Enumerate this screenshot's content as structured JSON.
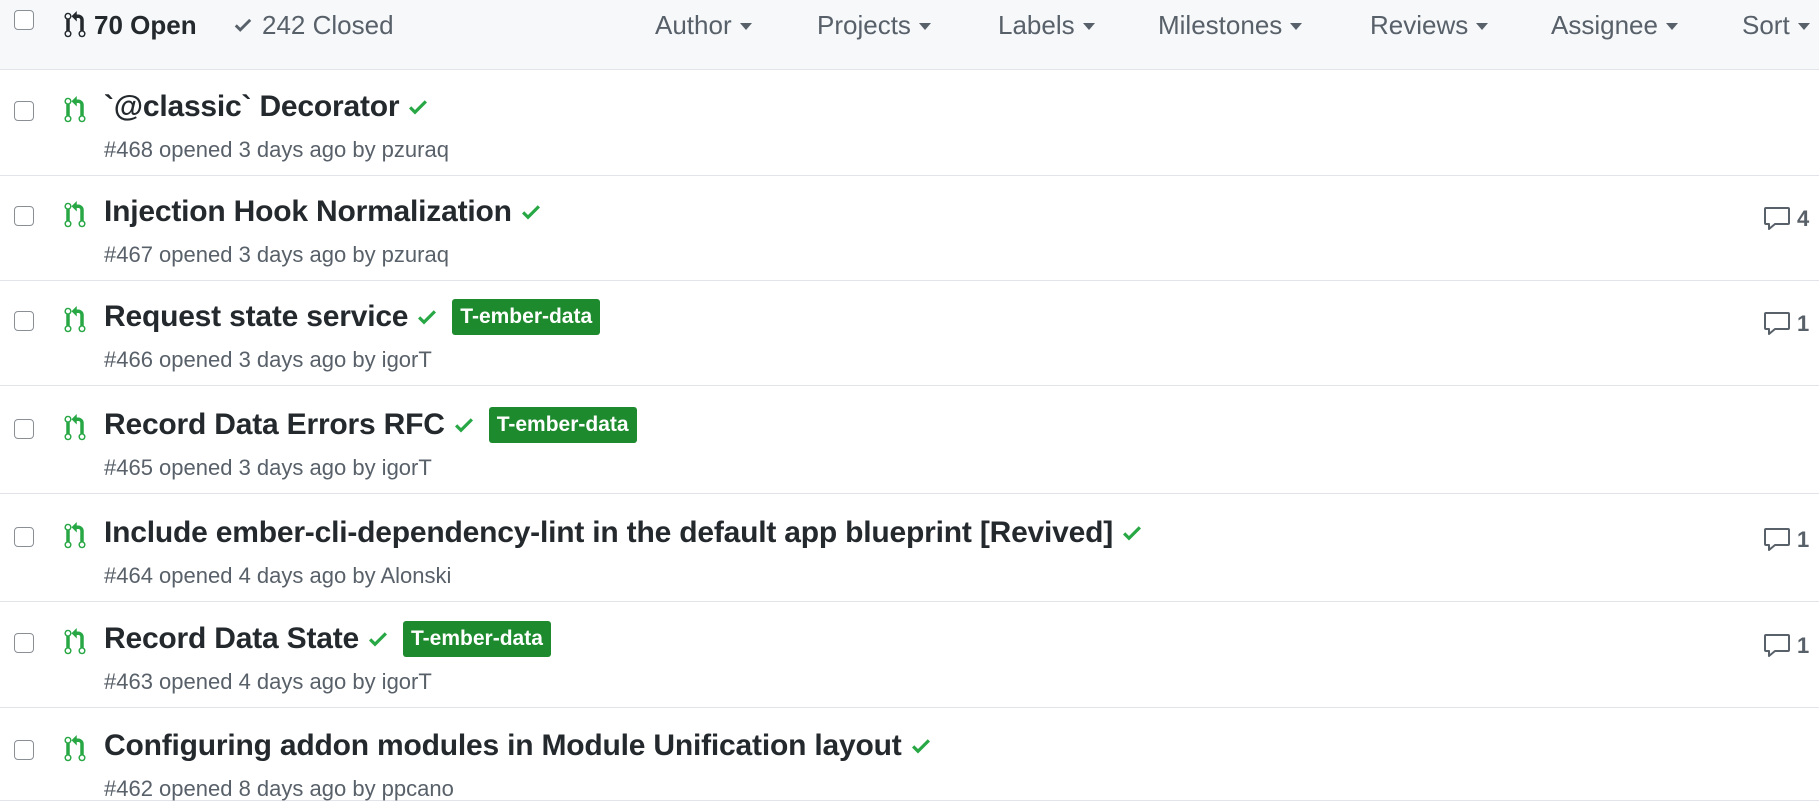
{
  "header": {
    "open_label": "70 Open",
    "closed_label": "242 Closed",
    "filters": [
      "Author",
      "Projects",
      "Labels",
      "Milestones",
      "Reviews",
      "Assignee",
      "Sort"
    ]
  },
  "colors": {
    "open_icon": "#28a745",
    "check": "#28a745",
    "label_bg": "#1e8a2e",
    "header_bg": "#f6f8fa",
    "muted_text": "#586069"
  },
  "icons": {
    "pr": "git-pull-request-icon",
    "check": "check-icon",
    "comment": "comment-icon",
    "caret": "triangle-down-icon"
  },
  "pull_requests": [
    {
      "title": "`@classic` Decorator",
      "meta": "#468 opened 3 days ago by pzuraq",
      "label": "",
      "comments": ""
    },
    {
      "title": "Injection Hook Normalization",
      "meta": "#467 opened 3 days ago by pzuraq",
      "label": "",
      "comments": "4"
    },
    {
      "title": "Request state service",
      "meta": "#466 opened 3 days ago by igorT",
      "label": "T-ember-data",
      "comments": "1"
    },
    {
      "title": "Record Data Errors RFC",
      "meta": "#465 opened 3 days ago by igorT",
      "label": "T-ember-data",
      "comments": ""
    },
    {
      "title": "Include ember-cli-dependency-lint in the default app blueprint [Revived]",
      "meta": "#464 opened 4 days ago by Alonski",
      "label": "",
      "comments": "1"
    },
    {
      "title": "Record Data State",
      "meta": "#463 opened 4 days ago by igorT",
      "label": "T-ember-data",
      "comments": "1"
    },
    {
      "title": "Configuring addon modules in Module Unification layout",
      "meta": "#462 opened 8 days ago by ppcano",
      "label": "",
      "comments": ""
    }
  ]
}
